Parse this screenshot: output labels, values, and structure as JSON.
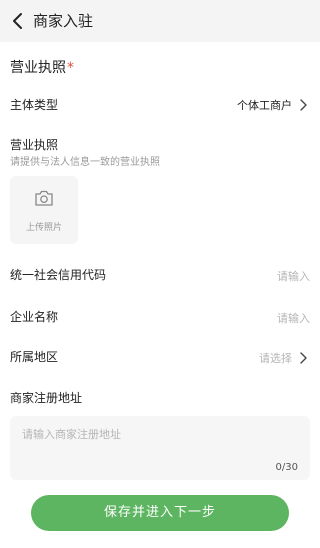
{
  "header": {
    "title": "商家入驻"
  },
  "license_section": {
    "title": "营业执照",
    "required_mark": "*"
  },
  "subject_type": {
    "label": "主体类型",
    "value": "个体工商户"
  },
  "license_upload": {
    "label": "营业执照",
    "hint": "请提供与法人信息一致的营业执照",
    "upload_label": "上传照片"
  },
  "credit_code": {
    "label": "统一社会信用代码",
    "placeholder": "请输入"
  },
  "company_name": {
    "label": "企业名称",
    "placeholder": "请输入"
  },
  "region": {
    "label": "所属地区",
    "placeholder": "请选择"
  },
  "address": {
    "label": "商家注册地址",
    "placeholder": "请输入商家注册地址",
    "counter": "0/30"
  },
  "footer": {
    "save_label": "保存并进入下一步"
  },
  "colors": {
    "accent": "#5db561",
    "required": "#e54d42",
    "placeholder": "#b5b5b5"
  }
}
